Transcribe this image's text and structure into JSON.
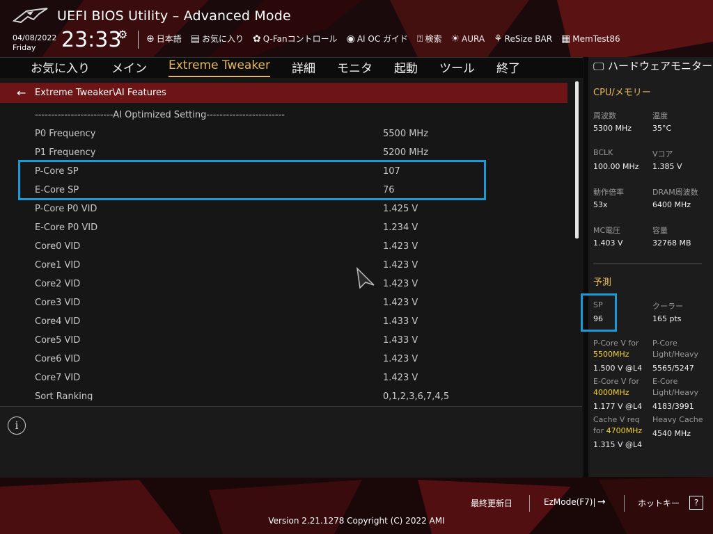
{
  "header": {
    "title": "UEFI BIOS Utility – Advanced Mode",
    "date": "04/08/2022",
    "day": "Friday",
    "time": "23:33",
    "toolbar": [
      {
        "icon": "globe-icon",
        "glyph": "⊕",
        "label": "日本語"
      },
      {
        "icon": "favorites-icon",
        "glyph": "▤",
        "label": "お気に入り"
      },
      {
        "icon": "fan-icon",
        "glyph": "✿",
        "label": "Q-Fanコントロール"
      },
      {
        "icon": "ai-oc-icon",
        "glyph": "◉",
        "label": "AI OC ガイド"
      },
      {
        "icon": "search-icon",
        "glyph": "⍰",
        "label": "検索"
      },
      {
        "icon": "aura-icon",
        "glyph": "☀",
        "label": "AURA"
      },
      {
        "icon": "resize-bar-icon",
        "glyph": "⚘",
        "label": "ReSize BAR"
      },
      {
        "icon": "memtest-icon",
        "glyph": "▦",
        "label": "MemTest86"
      }
    ]
  },
  "menu": {
    "items": [
      {
        "label": "お気に入り",
        "active": false
      },
      {
        "label": "メイン",
        "active": false
      },
      {
        "label": "Extreme Tweaker",
        "active": true
      },
      {
        "label": "詳細",
        "active": false
      },
      {
        "label": "モニタ",
        "active": false
      },
      {
        "label": "起動",
        "active": false
      },
      {
        "label": "ツール",
        "active": false
      },
      {
        "label": "終了",
        "active": false
      }
    ]
  },
  "breadcrumb": "Extreme Tweaker\\AI Features",
  "section_header": "------------------------AI Optimized Setting------------------------",
  "settings": [
    {
      "label": "P0 Frequency",
      "value": "5500 MHz"
    },
    {
      "label": "P1 Frequency",
      "value": "5200 MHz"
    },
    {
      "label": "P-Core SP",
      "value": "107"
    },
    {
      "label": "E-Core SP",
      "value": "76"
    },
    {
      "label": "P-Core P0 VID",
      "value": "1.425 V"
    },
    {
      "label": "E-Core P0 VID",
      "value": "1.234 V"
    },
    {
      "label": "Core0 VID",
      "value": "1.423 V"
    },
    {
      "label": "Core1 VID",
      "value": "1.423 V"
    },
    {
      "label": "Core2 VID",
      "value": "1.423 V"
    },
    {
      "label": "Core3 VID",
      "value": "1.423 V"
    },
    {
      "label": "Core4 VID",
      "value": "1.433 V"
    },
    {
      "label": "Core5 VID",
      "value": "1.433 V"
    },
    {
      "label": "Core6 VID",
      "value": "1.423 V"
    },
    {
      "label": "Core7 VID",
      "value": "1.423 V"
    },
    {
      "label": "Sort Ranking",
      "value": "0,1,2,3,6,7,4,5"
    }
  ],
  "info": {
    "icon": "info-icon",
    "glyph": "i"
  },
  "hardware_monitor": {
    "title": "ハードウェアモニター",
    "category": "CPU/メモリー",
    "stats": [
      {
        "label": "周波数",
        "value": "5300 MHz"
      },
      {
        "label": "温度",
        "value": "35°C"
      },
      {
        "label": "BCLK",
        "value": "100.00 MHz"
      },
      {
        "label": "Vコア",
        "value": "1.385 V"
      },
      {
        "label": "動作倍率",
        "value": "53x"
      },
      {
        "label": "DRAM周波数",
        "value": "6400 MHz"
      },
      {
        "label": "MC電圧",
        "value": "1.403 V"
      },
      {
        "label": "容量",
        "value": "32768 MB"
      }
    ],
    "prediction": {
      "title": "予測",
      "sp_label": "SP",
      "sp_value": "96",
      "cooler_label": "クーラー",
      "cooler_value": "165 pts",
      "pcore_v_label": "P-Core V for",
      "pcore_v_freq": "5500MHz",
      "pcore_v_value": "1.500 V @L4",
      "pcore_lh_label": "P-Core",
      "pcore_lh_label2": "Light/Heavy",
      "pcore_lh_value": "5565/5247",
      "ecore_v_label": "E-Core V for",
      "ecore_v_freq": "4000MHz",
      "ecore_v_value": "1.177 V @L4",
      "ecore_lh_label": "E-Core",
      "ecore_lh_label2": "Light/Heavy",
      "ecore_lh_value": "4183/3991",
      "cache_v_label": "Cache V req",
      "cache_v_for": "for",
      "cache_v_freq": "4700MHz",
      "cache_v_value": "1.315 V @L4",
      "heavy_cache_label": "Heavy Cache",
      "heavy_cache_value": "4540 MHz"
    }
  },
  "footer": {
    "last_modified": "最終更新日",
    "ezmode": "EzMode(F7)|",
    "ezmode_glyph": "→",
    "hotkeys": "ホットキー",
    "hotkeys_glyph": "?",
    "version": "Version 2.21.1278 Copyright (C) 2022 AMI"
  },
  "colors": {
    "accent": "#e8b85a",
    "highlight": "#1d9ad6",
    "breadcrumb_bg": "#6d1416",
    "freq_yellow": "#f0d030"
  }
}
